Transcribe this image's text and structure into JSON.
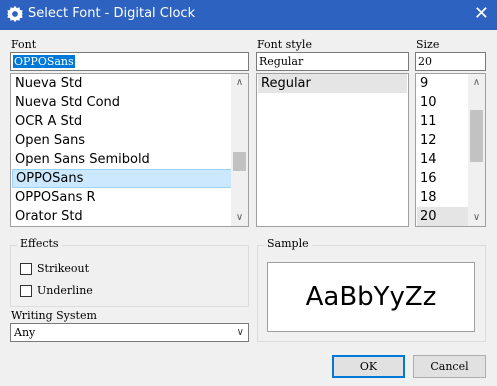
{
  "window": {
    "title": "Select Font - Digital Clock",
    "close_label": "✕"
  },
  "font": {
    "label": "Font",
    "value": "OPPOSans",
    "items": [
      "Nueva Std",
      "Nueva Std Cond",
      "OCR A Std",
      "Open Sans",
      "Open Sans Semibold",
      "OPPOSans",
      "OPPOSans R",
      "Orator Std"
    ],
    "selected": "OPPOSans"
  },
  "style": {
    "label": "Font style",
    "value": "Regular",
    "items": [
      "Regular"
    ],
    "selected": "Regular"
  },
  "size": {
    "label": "Size",
    "value": "20",
    "items": [
      "9",
      "10",
      "11",
      "12",
      "14",
      "16",
      "18",
      "20"
    ],
    "selected": "20"
  },
  "effects": {
    "label": "Effects",
    "strikeout_label": "Strikeout",
    "underline_label": "Underline",
    "strikeout_checked": false,
    "underline_checked": false
  },
  "sample": {
    "label": "Sample",
    "text": "AaBbYyZz"
  },
  "writing_system": {
    "label": "Writing System",
    "value": "Any"
  },
  "buttons": {
    "ok": "OK",
    "cancel": "Cancel"
  },
  "colors": {
    "titlebar": "#2d62c1",
    "selection": "#0078d7",
    "highlight": "#cce8ff"
  },
  "icons": {
    "title_icon": "gear-icon",
    "scroll_up": "chevron-up-icon",
    "scroll_down": "chevron-down-icon"
  }
}
